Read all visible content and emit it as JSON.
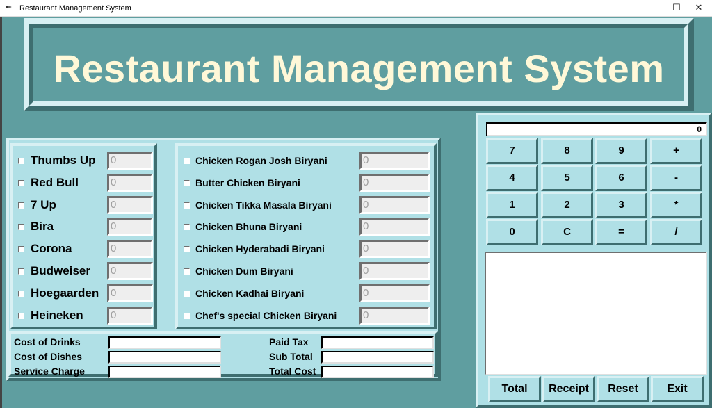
{
  "window": {
    "title": "Restaurant Management System",
    "minimize": "—",
    "maximize": "☐",
    "close": "✕"
  },
  "header": {
    "title": "Restaurant Management System"
  },
  "drinks": [
    {
      "name": "Thumbs Up",
      "qty": "0"
    },
    {
      "name": "Red Bull",
      "qty": "0"
    },
    {
      "name": "7 Up",
      "qty": "0"
    },
    {
      "name": "Bira",
      "qty": "0"
    },
    {
      "name": "Corona",
      "qty": "0"
    },
    {
      "name": "Budweiser",
      "qty": "0"
    },
    {
      "name": "Hoegaarden",
      "qty": "0"
    },
    {
      "name": "Heineken",
      "qty": "0"
    }
  ],
  "dishes": [
    {
      "name": "Chicken Rogan Josh Biryani",
      "qty": "0"
    },
    {
      "name": "Butter Chicken Biryani",
      "qty": "0"
    },
    {
      "name": "Chicken Tikka Masala Biryani",
      "qty": "0"
    },
    {
      "name": "Chicken Bhuna Biryani",
      "qty": "0"
    },
    {
      "name": "Chicken Hyderabadi Biryani",
      "qty": "0"
    },
    {
      "name": "Chicken Dum Biryani",
      "qty": "0"
    },
    {
      "name": "Chicken Kadhai Biryani",
      "qty": "0"
    },
    {
      "name": "Chef's special Chicken Biryani",
      "qty": "0"
    }
  ],
  "costs": {
    "cost_of_drinks": "Cost of Drinks",
    "cost_of_dishes": "Cost of Dishes",
    "service_charge": "Service Charge",
    "paid_tax": "Paid Tax",
    "sub_total": "Sub Total",
    "total_cost": "Total Cost"
  },
  "calculator": {
    "display": "0",
    "keys": [
      "7",
      "8",
      "9",
      "+",
      "4",
      "5",
      "6",
      "-",
      "1",
      "2",
      "3",
      "*",
      "0",
      "C",
      "=",
      "/"
    ]
  },
  "actions": {
    "total": "Total",
    "receipt": "Receipt",
    "reset": "Reset",
    "exit": "Exit"
  },
  "colors": {
    "background": "#5f9ea0",
    "panel": "#b0e0e6",
    "title_text": "#fff8d8"
  }
}
